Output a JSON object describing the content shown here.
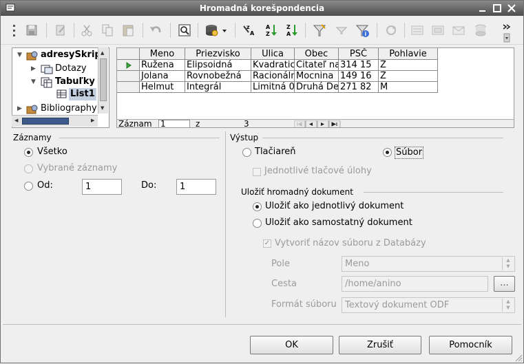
{
  "window": {
    "title": "Hromadná korešpondencia"
  },
  "datasource": {
    "tree": [
      {
        "label": "adresySkript"
      },
      {
        "label": "Dotazy"
      },
      {
        "label": "Tabuľky"
      },
      {
        "label": "List1"
      },
      {
        "label": "Bibliography"
      }
    ],
    "grid": {
      "headers": [
        "Meno",
        "Priezvisko",
        "Ulica",
        "Obec",
        "PSČ",
        "Pohlavie"
      ],
      "rows": [
        [
          "Ružena",
          "Elipsoidná",
          "Kvadratická",
          "Čitateľ na",
          "314 15",
          "Ž"
        ],
        [
          "Jolana",
          "Rovnobežná",
          "Racionálna",
          "Mocnina",
          "149 16",
          "Ž"
        ],
        [
          "Helmut",
          "Integrál",
          "Limitná 0",
          "Druhá De",
          "271 82",
          "M"
        ]
      ]
    },
    "record_bar": {
      "label": "Záznam",
      "current": "1",
      "of_label": "z",
      "total": "3"
    }
  },
  "records": {
    "title": "Záznamy",
    "all_label": "Všetko",
    "selected_label": "Vybrané záznamy",
    "from_label": "Od:",
    "from_value": "1",
    "to_label": "Do:",
    "to_value": "1"
  },
  "output": {
    "title": "Výstup",
    "printer_label": "Tlačiareň",
    "file_label": "Súbor",
    "single_jobs_label": "Jednotlivé tlačové úlohy"
  },
  "save": {
    "title": "Uložiť hromadný dokument",
    "single_doc_label": "Uložiť ako jednotlivý dokument",
    "separate_doc_label": "Uložiť ako samostatný dokument",
    "gen_filename_label": "Vytvoriť názov súboru z Databázy",
    "field_label": "Pole",
    "field_value": "Meno",
    "path_label": "Cesta",
    "path_value": "/home/anino",
    "browse_label": "...",
    "format_label": "Formát súboru",
    "format_value": "Textový dokument ODF"
  },
  "buttons": {
    "ok": "OK",
    "cancel": "Zrušiť",
    "help": "Pomocník"
  },
  "colors": {
    "titlebar": "#5e5e5e",
    "selection": "#c4cfe0"
  }
}
